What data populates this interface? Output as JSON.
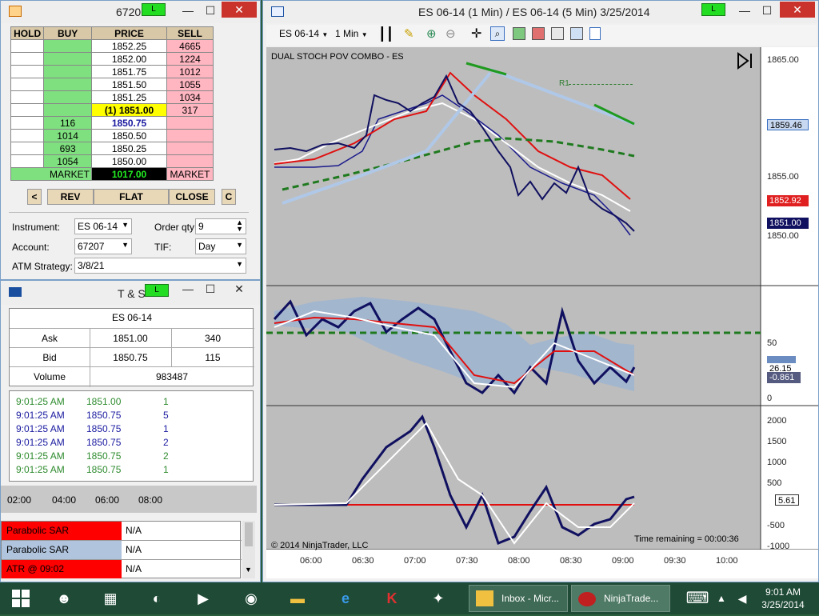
{
  "superdom": {
    "title": "6720",
    "link_label": "L",
    "headers": [
      "HOLD",
      "BUY",
      "PRICE",
      "SELL"
    ],
    "rows": [
      {
        "buy": "",
        "price": "1852.25",
        "sell": "4665"
      },
      {
        "buy": "",
        "price": "1852.00",
        "sell": "1224"
      },
      {
        "buy": "",
        "price": "1851.75",
        "sell": "1012"
      },
      {
        "buy": "",
        "price": "1851.50",
        "sell": "1055"
      },
      {
        "buy": "",
        "price": "1851.25",
        "sell": "1034"
      },
      {
        "buy": "",
        "price": "(1) 1851.00",
        "sell": "317"
      },
      {
        "buy": "116",
        "price": "1850.75",
        "sell": ""
      },
      {
        "buy": "1014",
        "price": "1850.50",
        "sell": ""
      },
      {
        "buy": "693",
        "price": "1850.25",
        "sell": ""
      },
      {
        "buy": "1054",
        "price": "1850.00",
        "sell": ""
      }
    ],
    "market_buy": "MARKET",
    "market_price": "1017.00",
    "market_sell": "MARKET",
    "btn_left": "<",
    "btn_rev": "REV",
    "btn_flat": "FLAT",
    "btn_close": "CLOSE",
    "btn_c": "C",
    "instrument_label": "Instrument:",
    "instrument_value": "ES 06-14",
    "order_qty_label": "Order qty:",
    "order_qty_value": "9",
    "account_label": "Account:",
    "account_value": "67207",
    "tif_label": "TIF:",
    "tif_value": "Day",
    "atm_label": "ATM Strategy:",
    "atm_value": "3/8/21"
  },
  "ts": {
    "title": "T & S",
    "link_label": "L",
    "instrument": "ES 06-14",
    "ask_label": "Ask",
    "ask_price": "1851.00",
    "ask_size": "340",
    "bid_label": "Bid",
    "bid_price": "1850.75",
    "bid_size": "115",
    "volume_label": "Volume",
    "volume_value": "983487",
    "trades": [
      {
        "time": "9:01:25 AM",
        "price": "1851.00",
        "size": "1",
        "color": "#2e8b2e"
      },
      {
        "time": "9:01:25 AM",
        "price": "1850.75",
        "size": "5",
        "color": "#1a1aa0"
      },
      {
        "time": "9:01:25 AM",
        "price": "1850.75",
        "size": "1",
        "color": "#1a1aa0"
      },
      {
        "time": "9:01:25 AM",
        "price": "1850.75",
        "size": "2",
        "color": "#1a1aa0"
      },
      {
        "time": "9:01:25 AM",
        "price": "1850.75",
        "size": "2",
        "color": "#2e8b2e"
      },
      {
        "time": "9:01:25 AM",
        "price": "1850.75",
        "size": "1",
        "color": "#2e8b2e"
      }
    ]
  },
  "mini_axis": [
    "02:00",
    "04:00",
    "06:00",
    "08:00"
  ],
  "indicators": [
    {
      "name": "Parabolic SAR",
      "value": "N/A",
      "color": "#ff0000"
    },
    {
      "name": "Parabolic SAR",
      "value": "N/A",
      "color": "#b0c4de"
    },
    {
      "name": "ATR @ 09:02",
      "value": "N/A",
      "color": "#ff0000"
    }
  ],
  "chart_window": {
    "title": "ES 06-14 (1 Min) / ES 06-14 (5 Min)  3/25/2014",
    "link_label": "L",
    "toolbar_instrument": "ES 06-14",
    "toolbar_interval": "1 Min",
    "panel_label": "DUAL STOCH POV COMBO - ES",
    "r1_label": "R1",
    "copyright": "© 2014 NinjaTrader, LLC",
    "time_remaining": "Time remaining = 00:00:36",
    "price_axis": [
      "1865.00",
      "1855.00",
      "1850.00"
    ],
    "price_tags": [
      {
        "label": "1859.46",
        "bg": "#c8d8f0",
        "fg": "#000"
      },
      {
        "label": "1852.92",
        "bg": "#e02020",
        "fg": "#fff"
      },
      {
        "label": "1851.00",
        "bg": "#101060",
        "fg": "#fff"
      }
    ],
    "stoch_axis": [
      "50",
      "0"
    ],
    "stoch_tags": [
      "26.15",
      "-0.861"
    ],
    "osc_axis": [
      "2000",
      "1500",
      "1000",
      "500",
      "-500",
      "-1000"
    ],
    "osc_tag": "5.61",
    "time_axis": [
      "06:00",
      "06:30",
      "07:00",
      "07:30",
      "08:00",
      "08:30",
      "09:00",
      "09:30",
      "10:00"
    ]
  },
  "taskbar": {
    "outlook_label": "Inbox - Micr...",
    "ninja_label": "NinjaTrade...",
    "time": "9:01 AM",
    "date": "3/25/2014"
  }
}
